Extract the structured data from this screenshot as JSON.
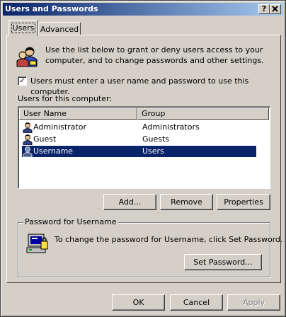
{
  "window": {
    "title": "Users and Passwords",
    "help_button": "?",
    "close_button": "X"
  },
  "tabs": [
    {
      "label": "Users",
      "active": true
    },
    {
      "label": "Advanced",
      "active": false
    }
  ],
  "intro": {
    "line1": "Use the list below to grant or deny users access to your",
    "line2": "computer, and to change passwords and other settings.",
    "icon": "users-icon"
  },
  "checkbox": {
    "label": "Users must enter a user name and password to use this computer.",
    "checked": true,
    "mark": "✓"
  },
  "user_list": {
    "label": "Users for this computer:",
    "columns": [
      "User Name",
      "Group"
    ],
    "rows": [
      {
        "name": "Administrator",
        "group": "Administrators",
        "selected": false
      },
      {
        "name": "Guest",
        "group": "Guests",
        "selected": false
      },
      {
        "name": "Username",
        "group": "Users",
        "selected": true
      }
    ]
  },
  "list_buttons": {
    "add": "Add...",
    "remove": "Remove",
    "properties": "Properties"
  },
  "password_group": {
    "title": "Password for Username",
    "text": "To change the password for Username, click Set Password.",
    "button": "Set Password...",
    "icon": "computer-password-icon"
  },
  "dialog_buttons": {
    "ok": "OK",
    "cancel": "Cancel",
    "apply": "Apply"
  },
  "colors": {
    "title_bar": "#0a246a",
    "selection": "#0a246a",
    "face": "#d4d0c8"
  }
}
